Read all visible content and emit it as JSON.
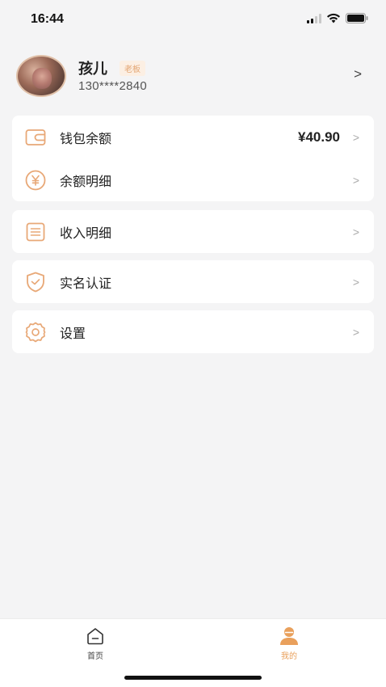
{
  "status_bar": {
    "time": "16:44"
  },
  "profile": {
    "name": "孩儿",
    "role_badge": "老板",
    "phone": "130****2840",
    "arrow": ">"
  },
  "menu": {
    "wallet_balance": {
      "label": "钱包余额",
      "value": "¥40.90",
      "icon": "wallet-icon"
    },
    "balance_details": {
      "label": "余额明细",
      "icon": "yen-circle-icon"
    },
    "income_details": {
      "label": "收入明细",
      "icon": "list-document-icon"
    },
    "real_name_auth": {
      "label": "实名认证",
      "icon": "shield-check-icon"
    },
    "settings": {
      "label": "设置",
      "icon": "gear-icon"
    },
    "arrow": ">"
  },
  "tab_bar": {
    "home_label": "首页",
    "mine_label": "我的",
    "active": "mine"
  },
  "colors": {
    "accent": "#e9a05c",
    "icon_stroke": "#e8a877",
    "background": "#f4f4f5"
  }
}
